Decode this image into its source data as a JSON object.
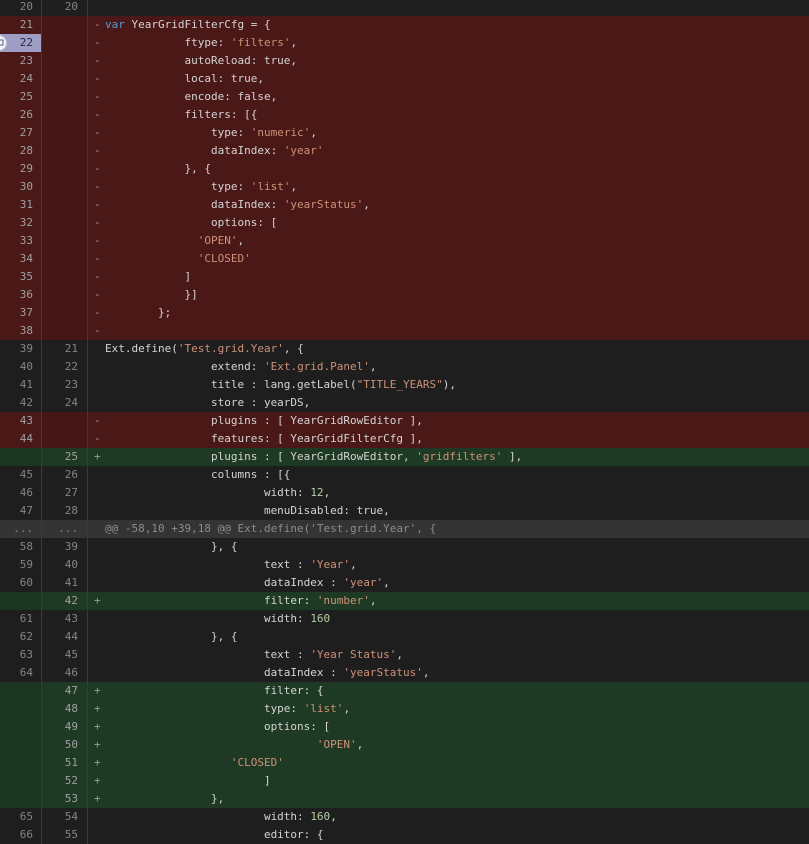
{
  "diff": {
    "rows": [
      {
        "type": "ctx",
        "old": "20",
        "new": "20",
        "sign": "",
        "code": ""
      },
      {
        "type": "del",
        "old": "21",
        "new": "",
        "sign": "-",
        "code": "var YearGridFilterCfg = {"
      },
      {
        "type": "del",
        "old": "22",
        "new": "",
        "sign": "-",
        "code": "            ftype: 'filters',",
        "selected": true
      },
      {
        "type": "del",
        "old": "23",
        "new": "",
        "sign": "-",
        "code": "            autoReload: true,"
      },
      {
        "type": "del",
        "old": "24",
        "new": "",
        "sign": "-",
        "code": "            local: true,"
      },
      {
        "type": "del",
        "old": "25",
        "new": "",
        "sign": "-",
        "code": "            encode: false,"
      },
      {
        "type": "del",
        "old": "26",
        "new": "",
        "sign": "-",
        "code": "            filters: [{"
      },
      {
        "type": "del",
        "old": "27",
        "new": "",
        "sign": "-",
        "code": "                type: 'numeric',"
      },
      {
        "type": "del",
        "old": "28",
        "new": "",
        "sign": "-",
        "code": "                dataIndex: 'year'"
      },
      {
        "type": "del",
        "old": "29",
        "new": "",
        "sign": "-",
        "code": "            }, {"
      },
      {
        "type": "del",
        "old": "30",
        "new": "",
        "sign": "-",
        "code": "                type: 'list',"
      },
      {
        "type": "del",
        "old": "31",
        "new": "",
        "sign": "-",
        "code": "                dataIndex: 'yearStatus',"
      },
      {
        "type": "del",
        "old": "32",
        "new": "",
        "sign": "-",
        "code": "                options: ["
      },
      {
        "type": "del",
        "old": "33",
        "new": "",
        "sign": "-",
        "code": "              'OPEN',"
      },
      {
        "type": "del",
        "old": "34",
        "new": "",
        "sign": "-",
        "code": "              'CLOSED'"
      },
      {
        "type": "del",
        "old": "35",
        "new": "",
        "sign": "-",
        "code": "            ]"
      },
      {
        "type": "del",
        "old": "36",
        "new": "",
        "sign": "-",
        "code": "            }]"
      },
      {
        "type": "del",
        "old": "37",
        "new": "",
        "sign": "-",
        "code": "        };"
      },
      {
        "type": "del",
        "old": "38",
        "new": "",
        "sign": "-",
        "code": ""
      },
      {
        "type": "ctx",
        "old": "39",
        "new": "21",
        "sign": "",
        "code": "Ext.define('Test.grid.Year', {"
      },
      {
        "type": "ctx",
        "old": "40",
        "new": "22",
        "sign": "",
        "code": "                extend: 'Ext.grid.Panel',"
      },
      {
        "type": "ctx",
        "old": "41",
        "new": "23",
        "sign": "",
        "code": "                title : lang.getLabel(\"TITLE_YEARS\"),"
      },
      {
        "type": "ctx",
        "old": "42",
        "new": "24",
        "sign": "",
        "code": "                store : yearDS,"
      },
      {
        "type": "del",
        "old": "43",
        "new": "",
        "sign": "-",
        "code": "                plugins : [ YearGridRowEditor ],"
      },
      {
        "type": "del",
        "old": "44",
        "new": "",
        "sign": "-",
        "code": "                features: [ YearGridFilterCfg ],"
      },
      {
        "type": "add",
        "old": "",
        "new": "25",
        "sign": "+",
        "code": "                plugins : [ YearGridRowEditor, 'gridfilters' ],"
      },
      {
        "type": "ctx",
        "old": "45",
        "new": "26",
        "sign": "",
        "code": "                columns : [{"
      },
      {
        "type": "ctx",
        "old": "46",
        "new": "27",
        "sign": "",
        "code": "                        width: 12,"
      },
      {
        "type": "ctx",
        "old": "47",
        "new": "28",
        "sign": "",
        "code": "                        menuDisabled: true,"
      },
      {
        "type": "hunk",
        "old": "...",
        "new": "...",
        "sign": "",
        "code": "@@ -58,10 +39,18 @@ Ext.define('Test.grid.Year', {"
      },
      {
        "type": "ctx",
        "old": "58",
        "new": "39",
        "sign": "",
        "code": "                }, {"
      },
      {
        "type": "ctx",
        "old": "59",
        "new": "40",
        "sign": "",
        "code": "                        text : 'Year',"
      },
      {
        "type": "ctx",
        "old": "60",
        "new": "41",
        "sign": "",
        "code": "                        dataIndex : 'year',"
      },
      {
        "type": "add",
        "old": "",
        "new": "42",
        "sign": "+",
        "code": "                        filter: 'number',"
      },
      {
        "type": "ctx",
        "old": "61",
        "new": "43",
        "sign": "",
        "code": "                        width: 160"
      },
      {
        "type": "ctx",
        "old": "62",
        "new": "44",
        "sign": "",
        "code": "                }, {"
      },
      {
        "type": "ctx",
        "old": "63",
        "new": "45",
        "sign": "",
        "code": "                        text : 'Year Status',"
      },
      {
        "type": "ctx",
        "old": "64",
        "new": "46",
        "sign": "",
        "code": "                        dataIndex : 'yearStatus',"
      },
      {
        "type": "add",
        "old": "",
        "new": "47",
        "sign": "+",
        "code": "                        filter: {"
      },
      {
        "type": "add",
        "old": "",
        "new": "48",
        "sign": "+",
        "code": "                        type: 'list',"
      },
      {
        "type": "add",
        "old": "",
        "new": "49",
        "sign": "+",
        "code": "                        options: ["
      },
      {
        "type": "add",
        "old": "",
        "new": "50",
        "sign": "+",
        "code": "                                'OPEN',"
      },
      {
        "type": "add",
        "old": "",
        "new": "51",
        "sign": "+",
        "code": "                   'CLOSED'"
      },
      {
        "type": "add",
        "old": "",
        "new": "52",
        "sign": "+",
        "code": "                        ]"
      },
      {
        "type": "add",
        "old": "",
        "new": "53",
        "sign": "+",
        "code": "                },"
      },
      {
        "type": "ctx",
        "old": "65",
        "new": "54",
        "sign": "",
        "code": "                        width: 160,"
      },
      {
        "type": "ctx",
        "old": "66",
        "new": "55",
        "sign": "",
        "code": "                        editor: {"
      }
    ]
  },
  "colors": {
    "deleted_bg": "#4b1818",
    "added_bg": "#1e3a24",
    "hunk_bg": "#343434",
    "string": "#ce9178",
    "number": "#b5cea8",
    "keyword": "#569cd6"
  },
  "icons": {
    "comment": "comment-bubble-icon"
  }
}
